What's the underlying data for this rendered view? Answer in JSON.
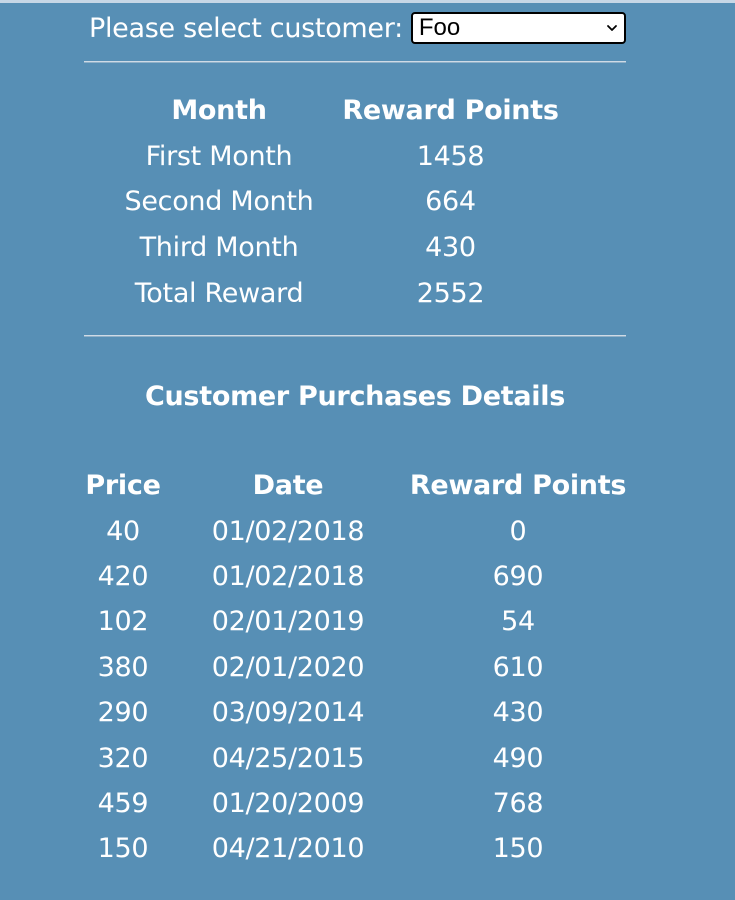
{
  "selector": {
    "label": "Please select customer:",
    "selected": "Foo"
  },
  "reward_summary": {
    "headers": [
      "Month",
      "Reward Points"
    ],
    "rows": [
      {
        "month": "First Month",
        "points": "1458"
      },
      {
        "month": "Second Month",
        "points": "664"
      },
      {
        "month": "Third Month",
        "points": "430"
      },
      {
        "month": "Total Reward",
        "points": "2552"
      }
    ]
  },
  "purchases": {
    "title": "Customer Purchases Details",
    "headers": [
      "Price",
      "Date",
      "Reward Points"
    ],
    "rows": [
      {
        "price": "40",
        "date": "01/02/2018",
        "points": "0"
      },
      {
        "price": "420",
        "date": "01/02/2018",
        "points": "690"
      },
      {
        "price": "102",
        "date": "02/01/2019",
        "points": "54"
      },
      {
        "price": "380",
        "date": "02/01/2020",
        "points": "610"
      },
      {
        "price": "290",
        "date": "03/09/2014",
        "points": "430"
      },
      {
        "price": "320",
        "date": "04/25/2015",
        "points": "490"
      },
      {
        "price": "459",
        "date": "01/20/2009",
        "points": "768"
      },
      {
        "price": "150",
        "date": "04/21/2010",
        "points": "150"
      }
    ]
  },
  "icons": {
    "select_chevron": "chevron-down-icon"
  },
  "colors": {
    "background": "#578fb5",
    "text": "#ffffff"
  }
}
